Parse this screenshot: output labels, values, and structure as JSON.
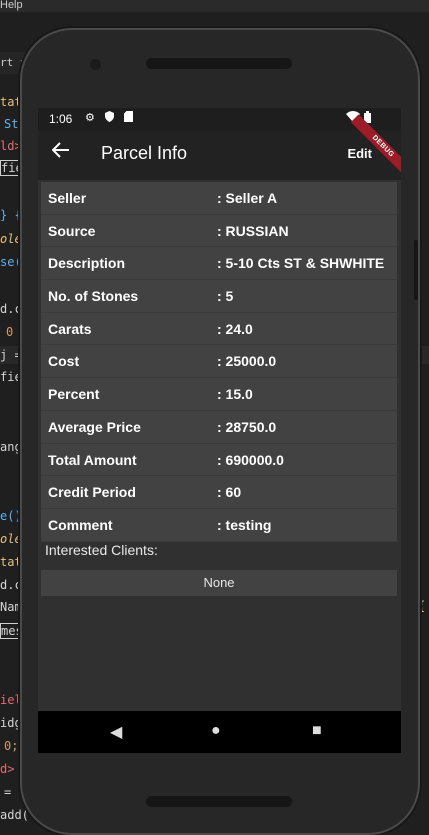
{
  "ide": {
    "menu_text": "Help",
    "tab_label": "rt ✕",
    "code_fragments": [
      "tate",
      "Sty",
      "ld>",
      "fie",
      "} {",
      "ole",
      "se(",
      "d.cl",
      "0",
      "j =",
      "fie",
      "ange",
      "e()",
      "ole",
      "tate",
      "d.cl",
      "Name",
      "mes",
      "iel",
      "idge",
      "0;",
      "d> ",
      "= ",
      "add("
    ],
    "right_fragment": "{"
  },
  "status_bar": {
    "time": "1:06"
  },
  "app_bar": {
    "back_icon": "arrow-left",
    "title": "Parcel Info",
    "edit_label": "Edit",
    "debug_banner": "DEBUG"
  },
  "parcel": {
    "rows": [
      {
        "label": "Seller",
        "value": ": Seller A"
      },
      {
        "label": "Source",
        "value": ": RUSSIAN"
      },
      {
        "label": "Description",
        "value": ": 5-10 Cts ST & SHWHITE"
      },
      {
        "label": "No. of Stones",
        "value": ": 5"
      },
      {
        "label": "Carats",
        "value": ": 24.0"
      },
      {
        "label": "Cost",
        "value": ": 25000.0"
      },
      {
        "label": "Percent",
        "value": ": 15.0"
      },
      {
        "label": "Average Price",
        "value": ": 28750.0"
      },
      {
        "label": "Total Amount",
        "value": ": 690000.0"
      },
      {
        "label": "Credit Period",
        "value": ": 60"
      },
      {
        "label": "Comment",
        "value": ": testing"
      }
    ]
  },
  "clients": {
    "label": "Interested Clients:",
    "value": "None"
  },
  "nav": {
    "back": "◀",
    "home": "●",
    "recents": "■"
  }
}
